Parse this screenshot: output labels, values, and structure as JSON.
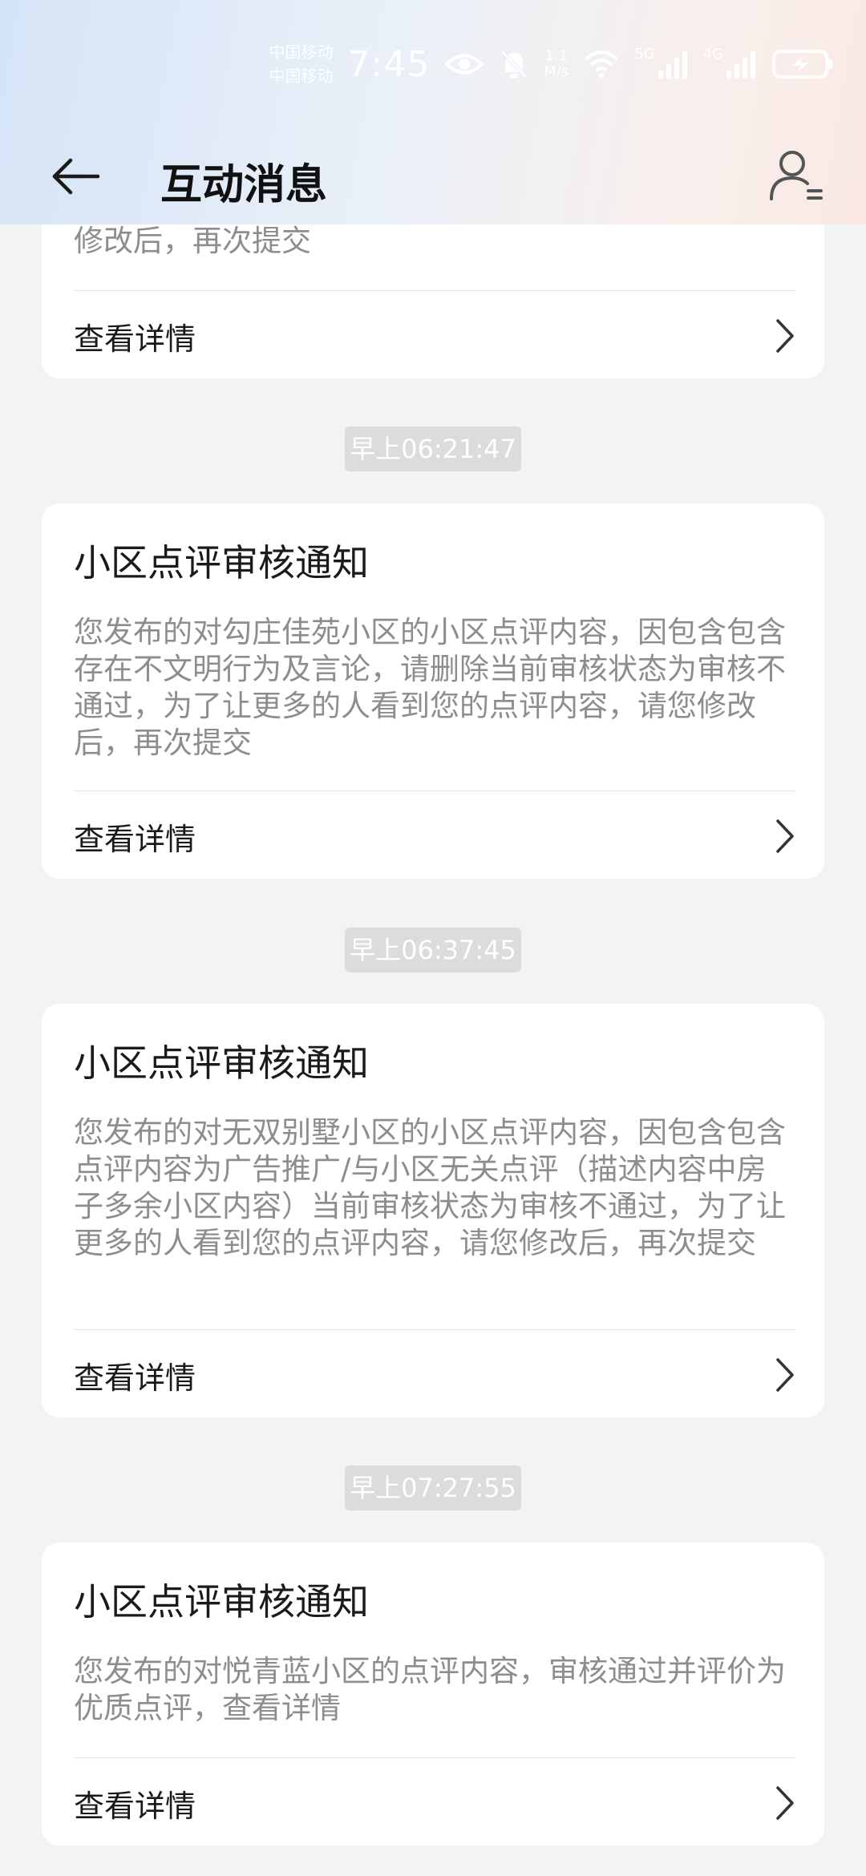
{
  "status_bar": {
    "carrier_1": "中国移动",
    "carrier_2": "中国移动",
    "time": "7:45",
    "speed_value": "1.1",
    "speed_unit": "M/s",
    "net_1": "5G",
    "net_2": "4G",
    "icons": [
      "eye-icon",
      "mute-bell-icon",
      "wifi-icon",
      "signal-icon",
      "battery-charging-icon"
    ]
  },
  "header": {
    "title": "互动消息",
    "back_icon": "back-arrow-icon",
    "user_icon": "user-settings-icon"
  },
  "messages": [
    {
      "time": "",
      "title": "",
      "body": "修改后，再次提交",
      "action": "查看详情"
    },
    {
      "time": "早上06:21:47",
      "title": "小区点评审核通知",
      "body": "您发布的对勾庄佳苑小区的小区点评内容，因包含包含存在不文明行为及言论，请删除当前审核状态为审核不通过，为了让更多的人看到您的点评内容，请您修改后，再次提交",
      "action": "查看详情"
    },
    {
      "time": "早上06:37:45",
      "title": "小区点评审核通知",
      "body": "您发布的对无双别墅小区的小区点评内容，因包含包含点评内容为广告推广/与小区无关点评（描述内容中房子多余小区内容）当前审核状态为审核不通过，为了让更多的人看到您的点评内容，请您修改后，再次提交",
      "action": "查看详情"
    },
    {
      "time": "早上07:27:55",
      "title": "小区点评审核通知",
      "body": "您发布的对悦青蓝小区的点评内容，审核通过并评价为优质点评，查看详情",
      "action": "查看详情"
    }
  ],
  "colors": {
    "background": "#f1f3f5",
    "card": "#ffffff",
    "body_text": "#8d8d8d",
    "time_chip": "#dcdcdc"
  }
}
